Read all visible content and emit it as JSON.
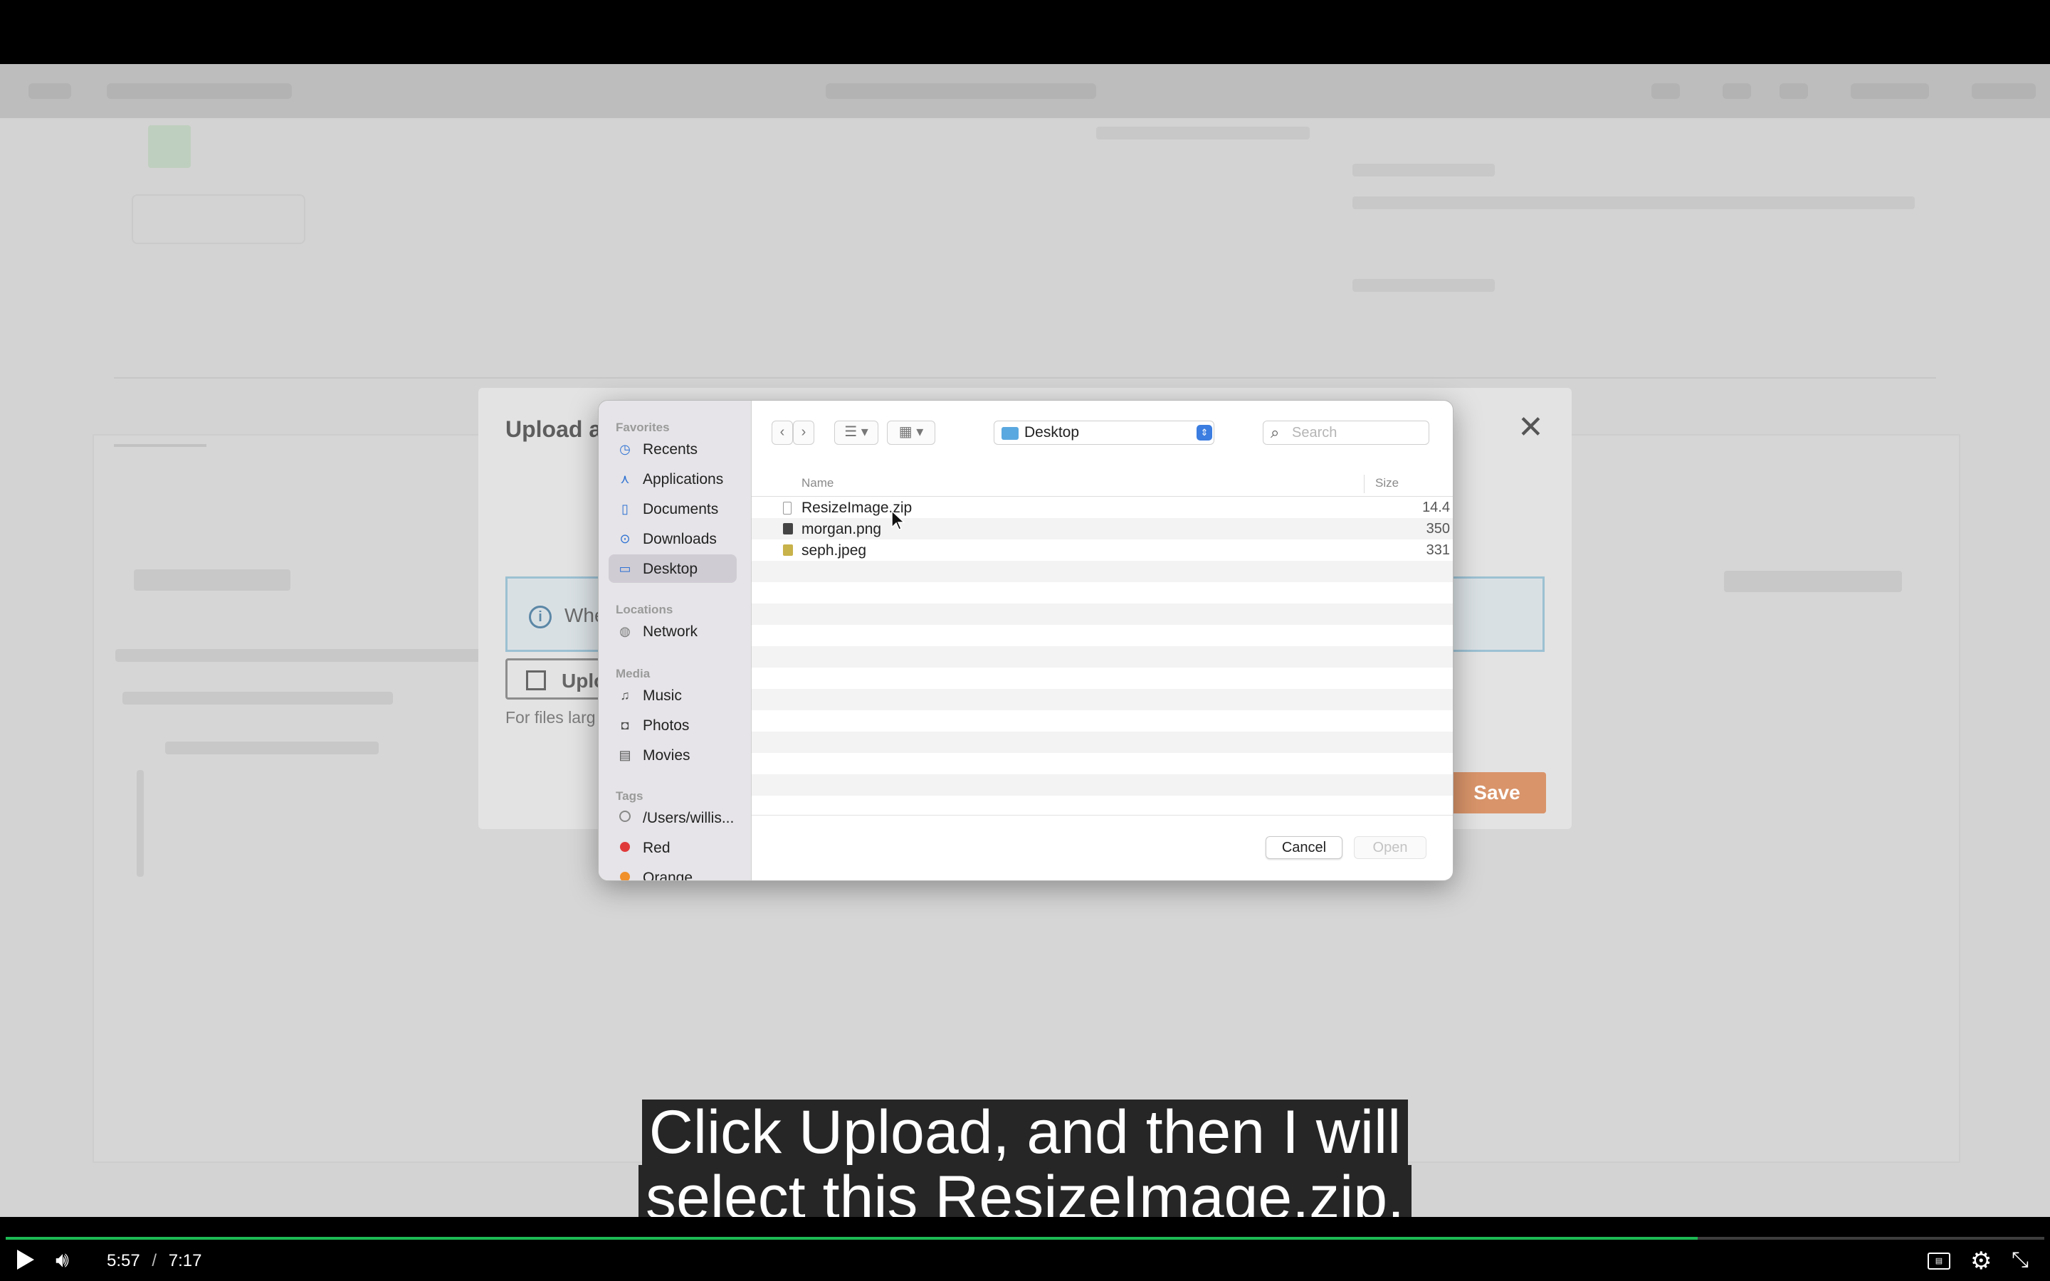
{
  "modal": {
    "title": "Upload a",
    "close_glyph": "✕",
    "info_icon": "i",
    "info_text": "Whe",
    "upload_label": "Uplo",
    "note_text": "For files larg",
    "save_label": "Save"
  },
  "dialog": {
    "sidebar": {
      "favorites_label": "Favorites",
      "favorites": [
        {
          "label": "Recents",
          "icon": "clock-icon"
        },
        {
          "label": "Applications",
          "icon": "applications-icon"
        },
        {
          "label": "Documents",
          "icon": "document-icon"
        },
        {
          "label": "Downloads",
          "icon": "download-icon"
        },
        {
          "label": "Desktop",
          "icon": "desktop-icon"
        }
      ],
      "locations_label": "Locations",
      "locations": [
        {
          "label": "Network",
          "icon": "globe-icon"
        }
      ],
      "media_label": "Media",
      "media": [
        {
          "label": "Music",
          "icon": "music-icon"
        },
        {
          "label": "Photos",
          "icon": "camera-icon"
        },
        {
          "label": "Movies",
          "icon": "film-icon"
        }
      ],
      "tags_label": "Tags",
      "tags": [
        {
          "label": "/Users/willis...",
          "color": "#ffffff"
        },
        {
          "label": "Red",
          "color": "#e0393a"
        },
        {
          "label": "Orange",
          "color": "#f0902a"
        }
      ]
    },
    "toolbar": {
      "back_glyph": "‹",
      "forward_glyph": "›",
      "view_list_glyph": "☰ ▾",
      "view_grid_glyph": "▦ ▾"
    },
    "location": "Desktop",
    "search_placeholder": "Search",
    "columns": {
      "name": "Name",
      "size": "Size"
    },
    "files": [
      {
        "name": "ResizeImage.zip",
        "size": "14.4",
        "kind": "zip"
      },
      {
        "name": "morgan.png",
        "size": "350",
        "kind": "png"
      },
      {
        "name": "seph.jpeg",
        "size": "331",
        "kind": "jpeg"
      }
    ],
    "cancel_label": "Cancel",
    "open_label": "Open"
  },
  "caption": {
    "line1": "Click Upload, and then I will",
    "line2": "select this ResizeImage.zip,"
  },
  "player": {
    "current_time": "5:57",
    "separator": "/",
    "duration": "7:17",
    "progress": 0.83,
    "accent_color": "#1db954"
  }
}
